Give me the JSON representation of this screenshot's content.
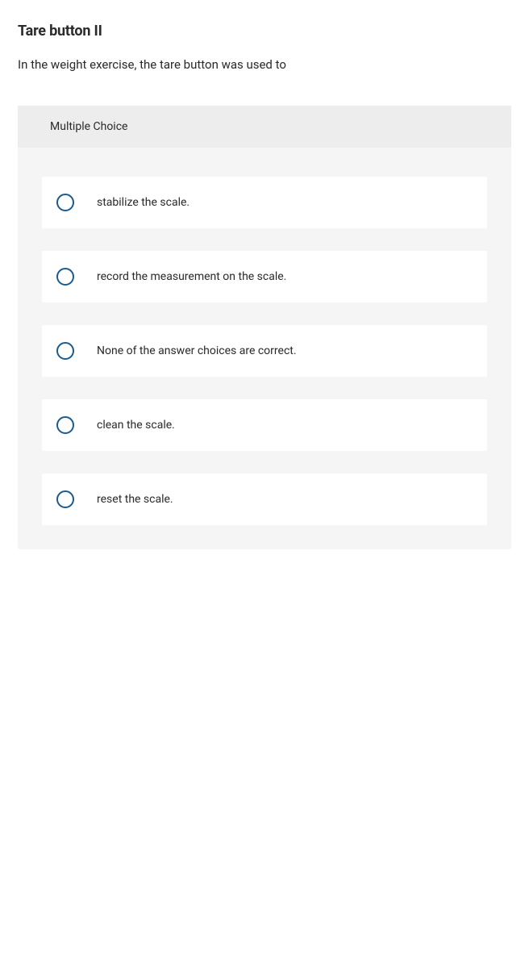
{
  "question": {
    "title": "Tare button II",
    "text": "In the weight exercise, the tare button was used to",
    "type_label": "Multiple Choice",
    "options": [
      {
        "text": "stabilize the scale."
      },
      {
        "text": "record the measurement on the scale."
      },
      {
        "text": "None of the answer choices are correct."
      },
      {
        "text": "clean the scale."
      },
      {
        "text": "reset the scale."
      }
    ]
  }
}
